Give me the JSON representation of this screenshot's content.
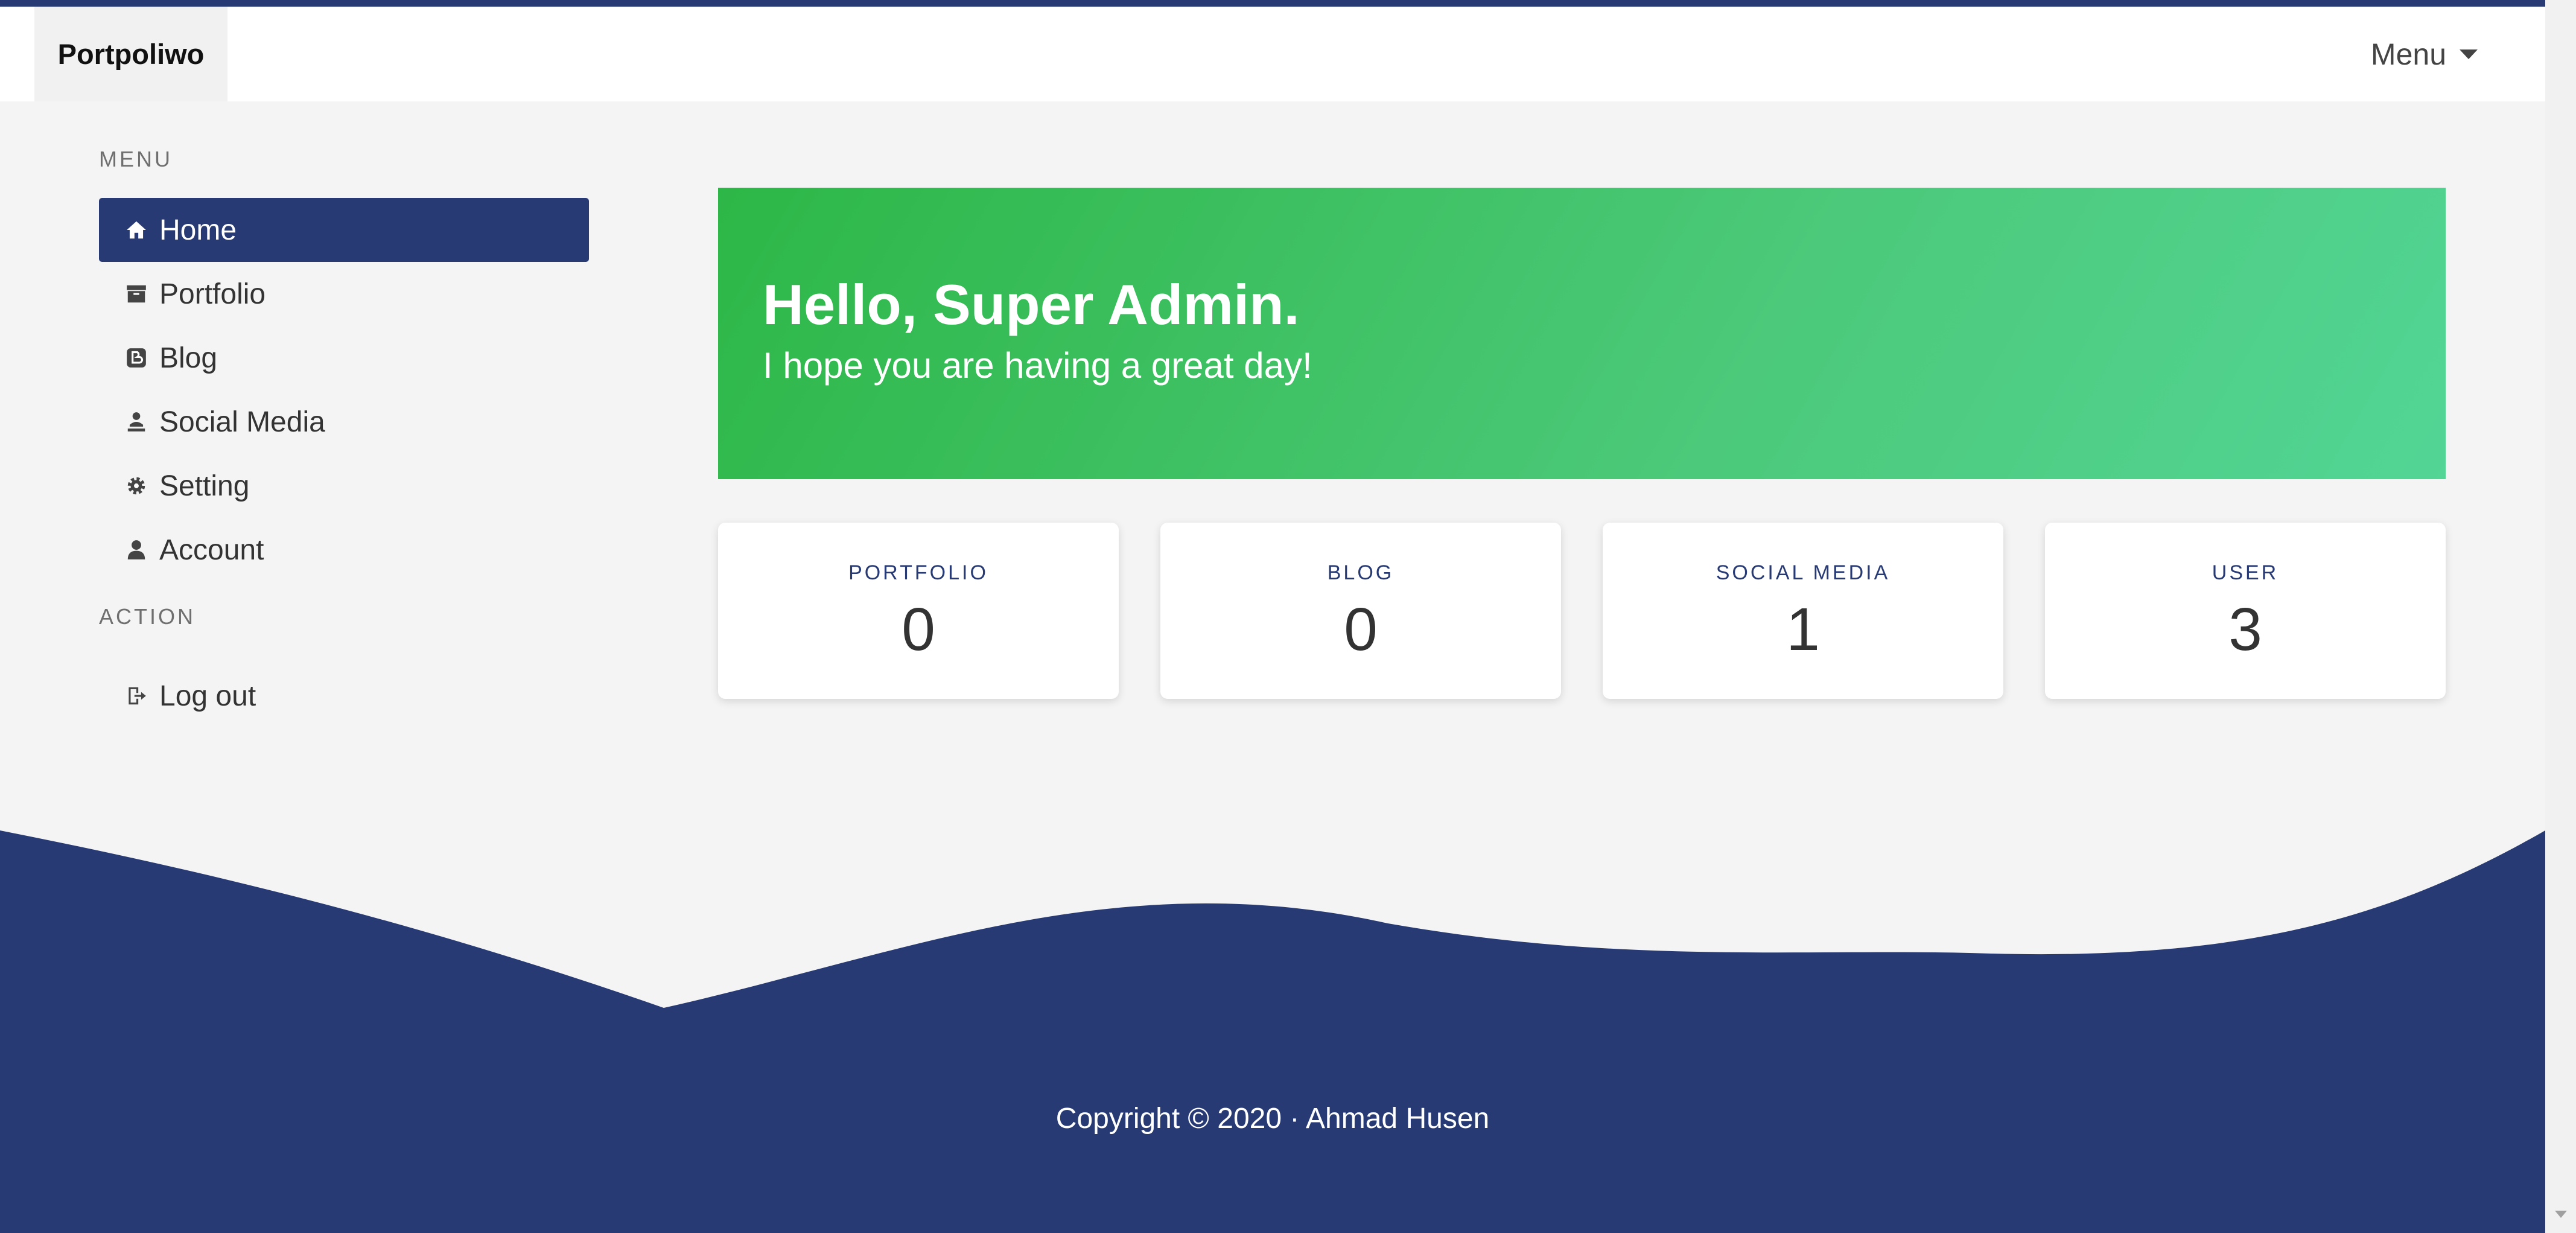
{
  "navbar": {
    "brand": "Portpoliwo",
    "menu_label": "Menu"
  },
  "sidebar": {
    "menu_heading": "MENU",
    "items": [
      {
        "label": "Home",
        "icon": "home-icon",
        "active": true
      },
      {
        "label": "Portfolio",
        "icon": "archive-icon"
      },
      {
        "label": "Blog",
        "icon": "blogger-icon"
      },
      {
        "label": "Social Media",
        "icon": "people-icon"
      },
      {
        "label": "Setting",
        "icon": "gear-icon"
      },
      {
        "label": "Account",
        "icon": "user-icon"
      }
    ],
    "action_heading": "ACTION",
    "actions": [
      {
        "label": "Log out",
        "icon": "logout-icon"
      }
    ]
  },
  "hero": {
    "title": "Hello, Super Admin.",
    "subtitle": "I hope you are having a great day!"
  },
  "stats": [
    {
      "label": "PORTFOLIO",
      "value": "0"
    },
    {
      "label": "BLOG",
      "value": "0"
    },
    {
      "label": "SOCIAL MEDIA",
      "value": "1"
    },
    {
      "label": "USER",
      "value": "3"
    }
  ],
  "footer": {
    "copyright": "Copyright © 2020 · Ahmad Husen"
  },
  "colors": {
    "primary": "#273a74",
    "accent_green": "#2db747",
    "background": "#f4f4f4"
  }
}
